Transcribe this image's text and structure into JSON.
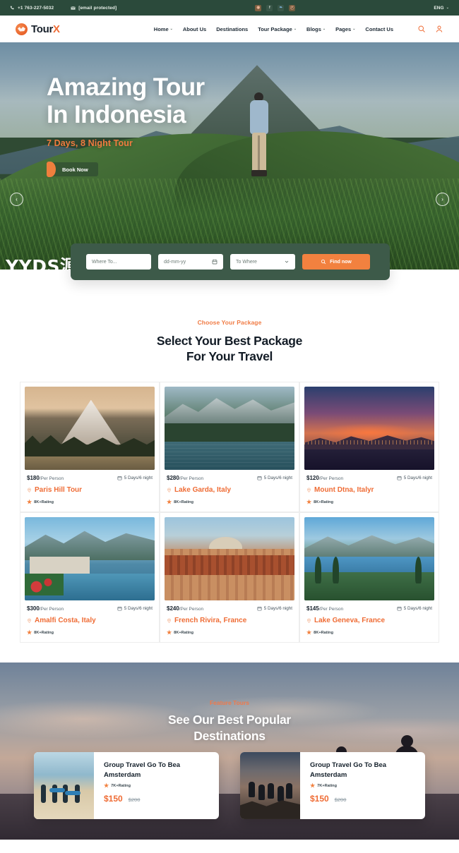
{
  "topbar": {
    "phone": "+1 763-227-5032",
    "email": "[email protected]",
    "phone_icon": "phone-icon",
    "email_icon": "envelope-icon",
    "socials": [
      {
        "name": "instagram-icon",
        "glyph": "◉"
      },
      {
        "name": "facebook-icon",
        "glyph": "f"
      },
      {
        "name": "twitter-icon",
        "glyph": "❧"
      },
      {
        "name": "pinterest-icon",
        "glyph": "Ⓟ"
      }
    ],
    "language": "ENG",
    "language_caret": "⌄"
  },
  "header": {
    "logo_text": "Tour",
    "logo_accent": "X",
    "nav": [
      {
        "label": "Home",
        "caret": "⌄"
      },
      {
        "label": "About Us",
        "caret": ""
      },
      {
        "label": "Destinations",
        "caret": ""
      },
      {
        "label": "Tour Package",
        "caret": "⌄"
      },
      {
        "label": "Blogs",
        "caret": "⌄"
      },
      {
        "label": "Pages",
        "caret": "⌄"
      },
      {
        "label": "Contact Us",
        "caret": ""
      }
    ],
    "search_icon": "search-icon",
    "account_icon": "user-icon"
  },
  "hero": {
    "title_line1": "Amazing Tour",
    "title_line2": "In Indonesia",
    "subtitle": "7 Days, 8 Night Tour",
    "cta": "Book Now",
    "prev_arrow": "‹",
    "next_arrow": "›",
    "watermark": "YYDS源码网"
  },
  "search_form": {
    "where_placeholder": "Where To...",
    "date_placeholder": "dd-mm-yy",
    "to_where_placeholder": "To Where",
    "submit_label": "Find now",
    "calendar_icon": "calendar-icon",
    "chevron_icon": "chevron-down-icon",
    "search_icon": "search-icon",
    "accent": "#f2813f"
  },
  "packages": {
    "eyebrow": "Choose Your Package",
    "title_line1": "Select Your Best Package",
    "title_line2": "For Your Travel",
    "cards": [
      {
        "price": "$180",
        "per": "/Per Person",
        "duration": "5 Days/6 night",
        "name": "Paris Hill Tour",
        "rating": "8K+Rating",
        "scene": "img-hood"
      },
      {
        "price": "$280",
        "per": "/Per Person",
        "duration": "5 Days/6 night",
        "name": "Lake Garda, Italy",
        "rating": "8K+Rating",
        "scene": "img-braies"
      },
      {
        "price": "$120",
        "per": "/Per Person",
        "duration": "5 Days/6 night",
        "name": "Mount Dtna, Italyr",
        "rating": "8K+Rating",
        "scene": "img-etna"
      },
      {
        "price": "$300",
        "per": "/Per Person",
        "duration": "5 Days/6 night",
        "name": "Amalfi Costa, Italy",
        "rating": "8K+Rating",
        "scene": "img-como"
      },
      {
        "price": "$240",
        "per": "/Per Person",
        "duration": "5 Days/6 night",
        "name": "French Rivira, France",
        "rating": "8K+Rating",
        "scene": "img-rome"
      },
      {
        "price": "$145",
        "per": "/Per Person",
        "duration": "5 Days/6 night",
        "name": "Lake Geneva, France",
        "rating": "8K+Rating",
        "scene": "img-geneva"
      }
    ],
    "duration_icon": "calendar-icon",
    "location_icon": "map-pin-icon",
    "star_icon": "star-icon",
    "accent": "#ef6c35"
  },
  "feature": {
    "eyebrow": "Feature Tours",
    "title_line1": "See Our Best Popular",
    "title_line2": "Destinations",
    "cards": [
      {
        "name_line1": "Group Travel Go To Bea",
        "name_line2": "Amsterdam",
        "rating": "7K+Rating",
        "price_new": "$150",
        "price_old": "$200",
        "thumb": "surf"
      },
      {
        "name_line1": "Group Travel Go To Bea",
        "name_line2": "Amsterdam",
        "rating": "7K+Rating",
        "price_new": "$150",
        "price_old": "$200",
        "thumb": "cliff"
      }
    ],
    "star_icon": "star-icon"
  }
}
